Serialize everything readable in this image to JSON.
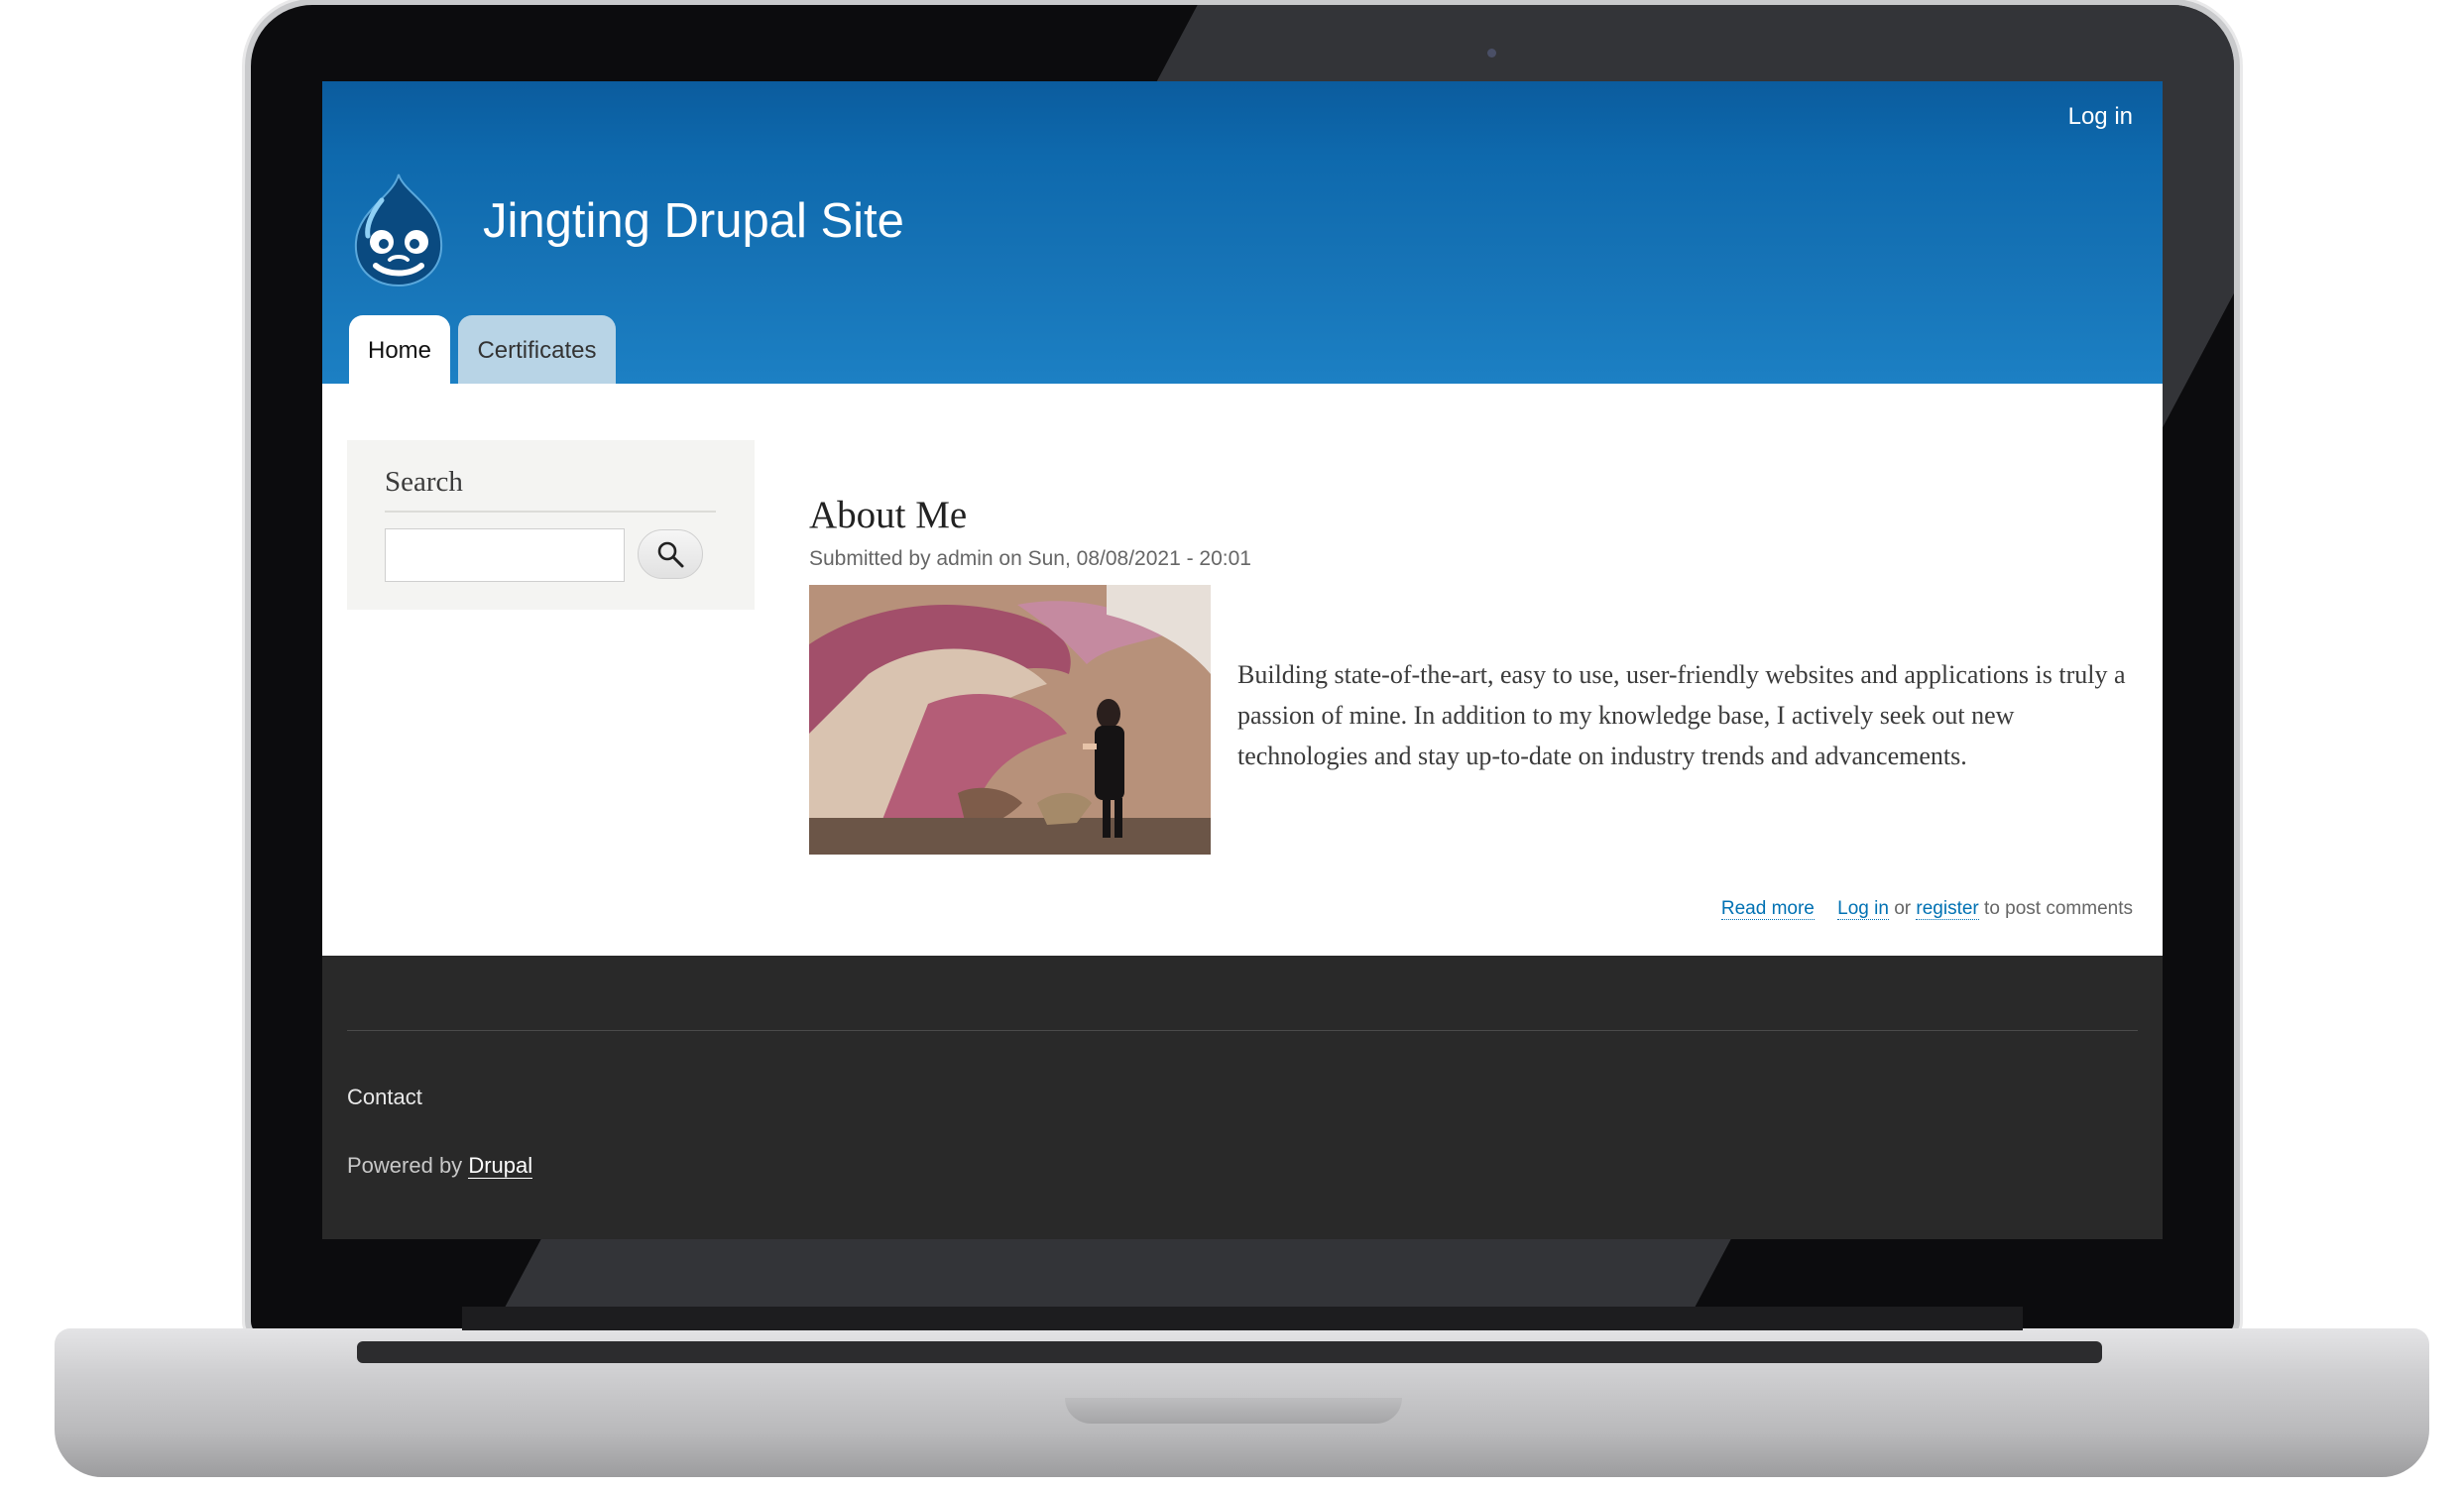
{
  "header": {
    "login_label": "Log in",
    "site_name": "Jingting Drupal Site",
    "tabs": [
      {
        "label": "Home",
        "active": true
      },
      {
        "label": "Certificates",
        "active": false
      }
    ]
  },
  "sidebar": {
    "search_heading": "Search",
    "search_value": "",
    "search_button_icon": "magnifier-icon"
  },
  "article": {
    "title": "About Me",
    "submitted": "Submitted by admin on Sun, 08/08/2021 - 20:01",
    "body": "Building state-of-the-art, easy to use, user-friendly websites and applications is truly a passion of mine. In addition to my knowledge base, I actively seek out new technologies and stay up-to-date on industry trends and advancements.",
    "read_more": "Read more",
    "login": "Log in",
    "or": "or",
    "register": "register",
    "post_comments": "to post comments"
  },
  "footer": {
    "contact": "Contact",
    "powered_by": "Powered by",
    "drupal": "Drupal"
  },
  "colors": {
    "header_blue": "#1673b6",
    "link_blue": "#0071b3",
    "footer_bg": "#292929"
  }
}
